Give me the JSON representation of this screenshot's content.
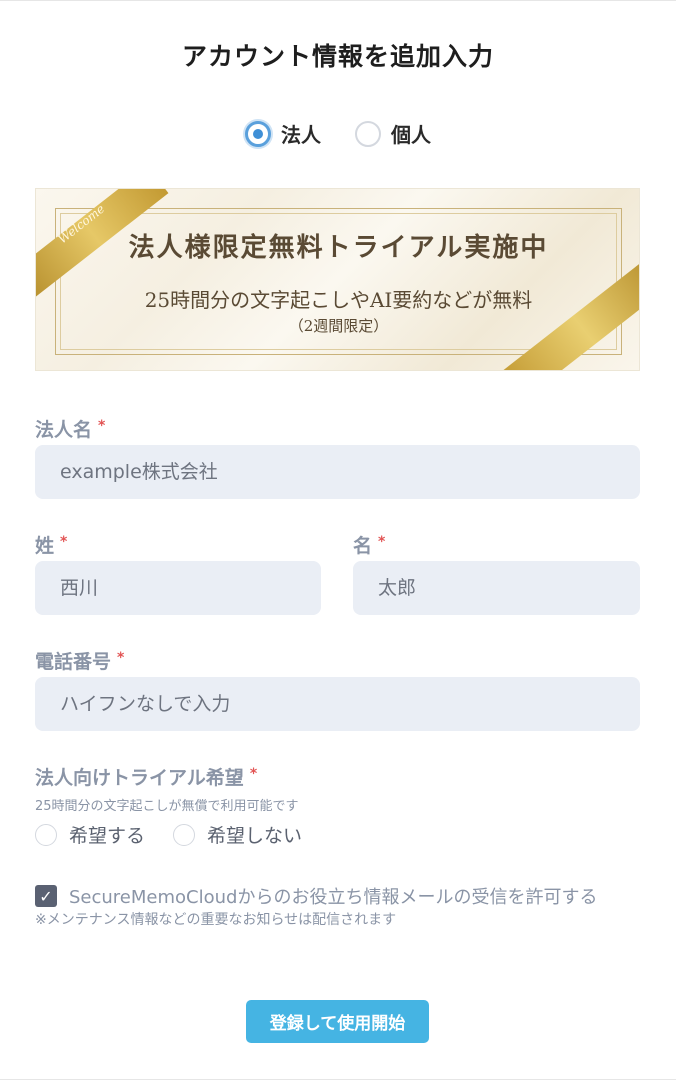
{
  "form": {
    "title": "アカウント情報を追加入力",
    "account_type": {
      "options": [
        {
          "label": "法人",
          "selected": true
        },
        {
          "label": "個人",
          "selected": false
        }
      ]
    },
    "banner": {
      "ribbon_text": "Welcome",
      "headline": "法人様限定無料トライアル実施中",
      "subline": "25時間分の文字起こしやAI要約などが無料",
      "note": "（2週間限定）"
    },
    "fields": {
      "company_name": {
        "label": "法人名",
        "required_mark": "*",
        "placeholder": "example株式会社"
      },
      "last_name": {
        "label": "姓",
        "required_mark": "*",
        "placeholder": "西川"
      },
      "first_name": {
        "label": "名",
        "required_mark": "*",
        "placeholder": "太郎"
      },
      "phone": {
        "label": "電話番号",
        "required_mark": "*",
        "placeholder": "ハイフンなしで入力"
      }
    },
    "trial": {
      "label": "法人向けトライアル希望",
      "required_mark": "*",
      "hint": "25時間分の文字起こしが無償で利用可能です",
      "options": [
        {
          "label": "希望する",
          "selected": false
        },
        {
          "label": "希望しない",
          "selected": false
        }
      ]
    },
    "consent": {
      "checked": true,
      "label": "SecureMemoCloudからのお役立ち情報メールの受信を許可する",
      "note": "※メンテナンス情報などの重要なお知らせは配信されます"
    },
    "submit_label": "登録して使用開始"
  },
  "colors": {
    "accent": "#45b4e3",
    "radio_selected": "#3f8fd6",
    "input_bg": "#eaeef5",
    "label": "#8a94a6",
    "required": "#e25454",
    "banner_gold": "#c9b27a"
  }
}
